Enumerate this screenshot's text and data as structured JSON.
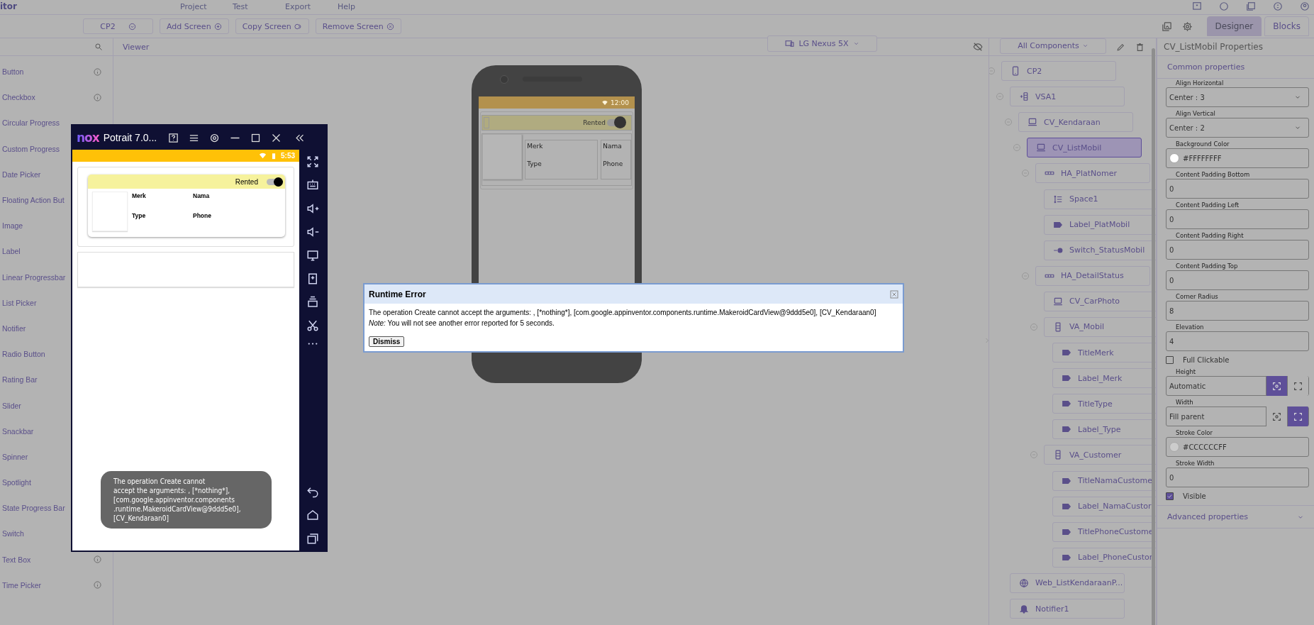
{
  "app_menu": {
    "title_fragment": "itor",
    "items": [
      "Project",
      "Test",
      "Export",
      "Help"
    ]
  },
  "toolbar": {
    "screen": "CP2",
    "buttons": [
      {
        "label": "Add Screen",
        "kind": "add"
      },
      {
        "label": "Copy Screen",
        "kind": "copy"
      },
      {
        "label": "Remove Screen",
        "kind": "remove"
      }
    ],
    "tabs": [
      {
        "label": "Designer",
        "selected": true
      },
      {
        "label": "Blocks",
        "selected": false
      }
    ]
  },
  "palette": {
    "items": [
      {
        "label": "Button",
        "info": true
      },
      {
        "label": "Checkbox",
        "info": true
      },
      {
        "label": "Circular Progress"
      },
      {
        "label": "Custom Progress"
      },
      {
        "label": "Date Picker"
      },
      {
        "label": "Floating Action But"
      },
      {
        "label": "Image"
      },
      {
        "label": "Label"
      },
      {
        "label": "Linear Progressbar"
      },
      {
        "label": "List Picker"
      },
      {
        "label": "Notifier"
      },
      {
        "label": "Radio Button"
      },
      {
        "label": "Rating Bar"
      },
      {
        "label": "Slider"
      },
      {
        "label": "Snackbar"
      },
      {
        "label": "Spinner"
      },
      {
        "label": "Spotlight"
      },
      {
        "label": "State Progress Bar"
      },
      {
        "label": "Switch"
      },
      {
        "label": "Text Box",
        "info": true
      },
      {
        "label": "Time Picker",
        "info": true
      }
    ]
  },
  "viewer": {
    "title": "Viewer",
    "device": "LG Nexus 5X",
    "preview": {
      "time": "12:00",
      "status_label": "Rented",
      "switch_on": true,
      "labels": [
        "Merk",
        "Nama",
        "Type",
        "Phone"
      ]
    }
  },
  "dialog": {
    "title": "Runtime Error",
    "message": "The operation Create cannot accept the arguments: , [*nothing*], [com.google.appinventor.components.runtime.MakeroidCardView@9ddd5e0], [CV_Kendaraan0]",
    "note": "*Note:* You will not see another error reported for 5 seconds.",
    "button": "Dismiss"
  },
  "emulator": {
    "logo": "nox",
    "title": "Potrait 7.0...",
    "time": "5:53",
    "status_label": "Rented",
    "switch_on": true,
    "labels": [
      "Merk",
      "Nama",
      "Type",
      "Phone"
    ],
    "toast_lines": [
      "The operation Create cannot",
      "accept the arguments: , [*nothing*],",
      "[com.google.appinventor.components",
      ".runtime.MakeroidCardView@9ddd5e0],",
      "[CV_Kendaraan0]"
    ]
  },
  "components": {
    "filter": "All Components",
    "tree": [
      {
        "label": "CP2",
        "kind": "screen",
        "selected": false,
        "expanded": true,
        "children": [
          {
            "label": "VSA1",
            "kind": "vscroll",
            "selected": false,
            "expanded": true,
            "children": [
              {
                "label": "CV_Kendaraan",
                "kind": "card",
                "selected": false,
                "expanded": true,
                "children": [
                  {
                    "label": "CV_ListMobil",
                    "kind": "card",
                    "selected": true,
                    "expanded": true,
                    "children": [
                      {
                        "label": "HA_PlatNomer",
                        "kind": "hbox",
                        "selected": false,
                        "expanded": true,
                        "children": [
                          {
                            "label": "Space1",
                            "kind": "space",
                            "selected": false
                          },
                          {
                            "label": "Label_PlatMobil",
                            "kind": "label",
                            "selected": false
                          },
                          {
                            "label": "Switch_StatusMobil",
                            "kind": "switch",
                            "selected": false
                          }
                        ]
                      },
                      {
                        "label": "HA_DetailStatus",
                        "kind": "hbox",
                        "selected": false,
                        "expanded": true,
                        "children": [
                          {
                            "label": "CV_CarPhoto",
                            "kind": "card",
                            "selected": false
                          },
                          {
                            "label": "VA_Mobil",
                            "kind": "vbox",
                            "selected": false,
                            "expanded": true,
                            "children": [
                              {
                                "label": "TitleMerk",
                                "kind": "label",
                                "selected": false
                              },
                              {
                                "label": "Label_Merk",
                                "kind": "label",
                                "selected": false
                              },
                              {
                                "label": "TitleType",
                                "kind": "label",
                                "selected": false
                              },
                              {
                                "label": "Label_Type",
                                "kind": "label",
                                "selected": false
                              }
                            ]
                          },
                          {
                            "label": "VA_Customer",
                            "kind": "vbox",
                            "selected": false,
                            "expanded": true,
                            "children": [
                              {
                                "label": "TitleNamaCustome",
                                "kind": "label",
                                "selected": false
                              },
                              {
                                "label": "Label_NamaCustor",
                                "kind": "label",
                                "selected": false
                              },
                              {
                                "label": "TitlePhoneCustome",
                                "kind": "label",
                                "selected": false
                              },
                              {
                                "label": "Label_PhoneCustor",
                                "kind": "label",
                                "selected": false
                              }
                            ]
                          }
                        ]
                      }
                    ]
                  }
                ]
              }
            ]
          },
          {
            "label": "Web_ListKendaraanP...",
            "kind": "web",
            "selected": false
          },
          {
            "label": "Notifier1",
            "kind": "notifier",
            "selected": false
          }
        ]
      }
    ]
  },
  "properties": {
    "title": "CV_ListMobil Properties",
    "section": "Common properties",
    "advanced": "Advanced properties",
    "fields": [
      {
        "kind": "select",
        "label": "Align Horizontal",
        "value": "Center : 3"
      },
      {
        "kind": "select",
        "label": "Align Vertical",
        "value": "Center : 2"
      },
      {
        "kind": "color",
        "label": "Background Color",
        "value": "#FFFFFFFF",
        "color": "#ffffff"
      },
      {
        "kind": "text",
        "label": "Content Padding Bottom",
        "value": "0"
      },
      {
        "kind": "text",
        "label": "Content Padding Left",
        "value": "0"
      },
      {
        "kind": "text",
        "label": "Content Padding Right",
        "value": "0"
      },
      {
        "kind": "text",
        "label": "Content Padding Top",
        "value": "0"
      },
      {
        "kind": "text",
        "label": "Corner Radius",
        "value": "8"
      },
      {
        "kind": "text",
        "label": "Elevation",
        "value": "4"
      },
      {
        "kind": "checkbox",
        "label": "Full Clickable",
        "checked": false
      },
      {
        "kind": "size",
        "label": "Height",
        "value": "Automatic",
        "options": [
          {
            "kind": "auto",
            "selected": true
          },
          {
            "kind": "fill",
            "selected": false
          }
        ]
      },
      {
        "kind": "size",
        "label": "Width",
        "value": "Fill parent",
        "options": [
          {
            "kind": "auto",
            "selected": false
          },
          {
            "kind": "fill",
            "selected": true
          }
        ]
      },
      {
        "kind": "color",
        "label": "Stroke Color",
        "value": "#CCCCCCFF",
        "color": "#cccccc"
      },
      {
        "kind": "text",
        "label": "Stroke Width",
        "value": "0"
      },
      {
        "kind": "checkbox",
        "label": "Visible",
        "checked": true
      }
    ]
  }
}
